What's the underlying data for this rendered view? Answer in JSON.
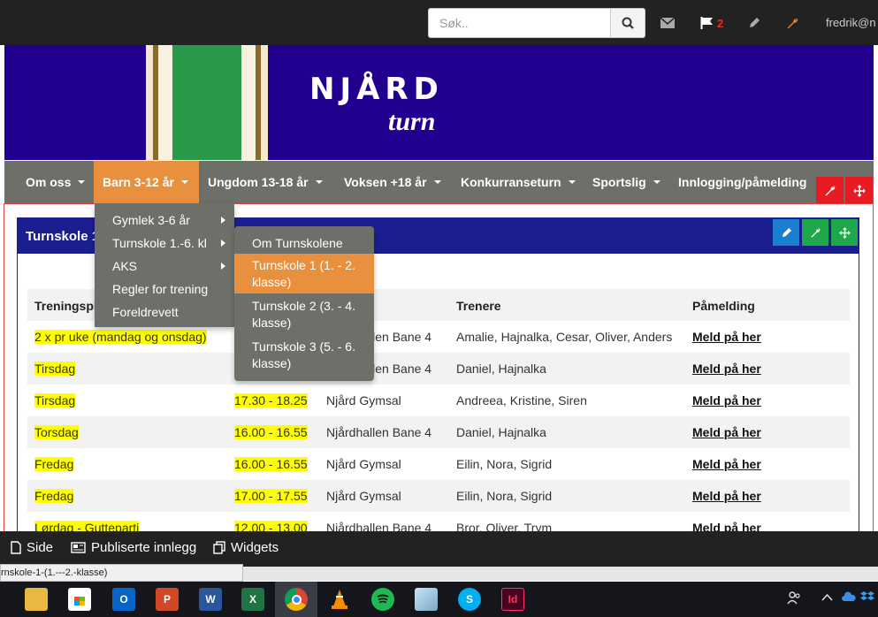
{
  "adminbar": {
    "search_placeholder": "Søk..",
    "flag_count": "2",
    "username": "fredrik@n"
  },
  "banner": {
    "logo": "NJÅRD",
    "sub": "turn"
  },
  "nav": {
    "items": [
      {
        "label": "Om oss"
      },
      {
        "label": "Barn 3-12 år"
      },
      {
        "label": "Ungdom 13-18 år"
      },
      {
        "label": "Voksen +18 år"
      },
      {
        "label": "Konkurranseturn"
      },
      {
        "label": "Sportslig"
      },
      {
        "label": "Innlogging/påmelding"
      }
    ]
  },
  "dropdown1": {
    "items": [
      {
        "label": "Gymlek 3-6 år"
      },
      {
        "label": "Turnskole 1.-6. kl"
      },
      {
        "label": "AKS"
      },
      {
        "label": "Regler for trening"
      },
      {
        "label": "Foreldrevett"
      }
    ]
  },
  "dropdown2": {
    "items": [
      {
        "label": "Om Turnskolene"
      },
      {
        "label": "Turnskole 1 (1. - 2. klasse)"
      },
      {
        "label": "Turnskole 2 (3. - 4. klasse)"
      },
      {
        "label": "Turnskole 3 (5. - 6. klasse)"
      }
    ]
  },
  "panel": {
    "title": "Turnskole 1"
  },
  "table": {
    "headers": {
      "plan": "Treningsplan",
      "trainers": "Trenere",
      "signup": "Påmelding"
    },
    "rows": [
      {
        "day": "2 x pr uke (mandag og onsdag)",
        "time": "",
        "place": "Njårdhallen Bane 4",
        "trainers": "Amalie, Hajnalka, Cesar, Oliver, Anders",
        "signup": "Meld på her"
      },
      {
        "day": "Tirsdag",
        "time": "",
        "place": "Njårdhallen Bane 4",
        "trainers": "Daniel, Hajnalka",
        "signup": "Meld på her"
      },
      {
        "day": "Tirsdag",
        "time": "17.30 - 18.25",
        "place": "Njård Gymsal",
        "trainers": "Andreea, Kristine, Siren",
        "signup": "Meld på her"
      },
      {
        "day": "Torsdag",
        "time": "16.00 - 16.55",
        "place": "Njårdhallen Bane 4",
        "trainers": "Daniel, Hajnalka",
        "signup": "Meld på her"
      },
      {
        "day": "Fredag",
        "time": "16.00 - 16.55",
        "place": "Njård Gymsal",
        "trainers": "Eilin, Nora, Sigrid",
        "signup": "Meld på her"
      },
      {
        "day": "Fredag",
        "time": "17.00 - 17.55",
        "place": "Njård Gymsal",
        "trainers": "Eilin, Nora, Sigrid",
        "signup": "Meld på her"
      },
      {
        "day": "Lørdag - Gutteparti",
        "time": "12.00 - 13.00",
        "place": "Njårdhallen Bane 4",
        "trainers": "Bror, Oliver, Trym",
        "signup": "Meld på her"
      }
    ]
  },
  "bottombar": {
    "side": "Side",
    "posts": "Publiserte innlegg",
    "widgets": "Widgets"
  },
  "status_url": "rnskole-1-(1.---2.-klasse)",
  "colors": {
    "banner": "#21008f",
    "nav": "#6d7068",
    "active": "#e8903e",
    "panel": "#1b1e8e",
    "highlight": "#ffff00",
    "red": "#e81b22"
  }
}
